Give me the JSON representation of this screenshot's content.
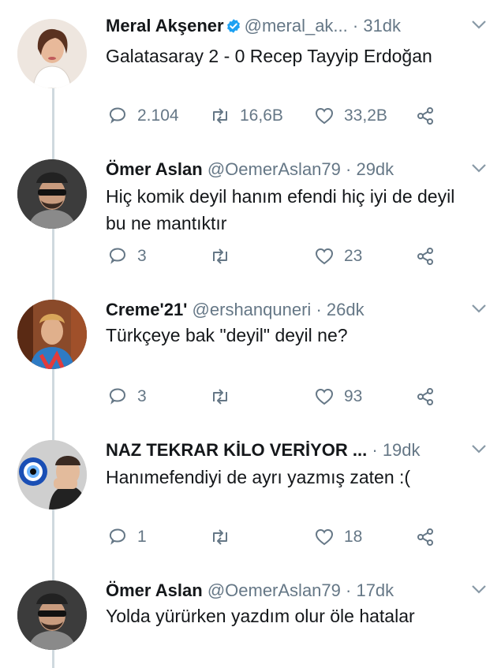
{
  "tweets": [
    {
      "name": "Meral Akşener",
      "verified": true,
      "handle": "@meral_ak...",
      "time": "· 31dk",
      "text": "Galatasaray 2 - 0 Recep Tayyip Erdoğan",
      "replies": "2.104",
      "retweets": "16,6B",
      "likes": "33,2B"
    },
    {
      "name": "Ömer Aslan",
      "verified": false,
      "handle": "@OemerAslan79",
      "time": "· 29dk",
      "text": "Hiç komik deyil hanım efendi hiç iyi de deyil bu ne mantıktır",
      "replies": "3",
      "retweets": "",
      "likes": "23"
    },
    {
      "name": "Creme'21'",
      "verified": false,
      "handle": "@ershanquneri",
      "time": "· 26dk",
      "text": "Türkçeye bak \"deyil\" deyil ne?",
      "replies": "3",
      "retweets": "",
      "likes": "93"
    },
    {
      "name": "NAZ TEKRAR KİLO VERİYOR ...",
      "verified": false,
      "handle": "",
      "time": "· 19dk",
      "text": "Hanımefendiyi de ayrı yazmış zaten :(",
      "replies": "1",
      "retweets": "",
      "likes": "18"
    },
    {
      "name": "Ömer Aslan",
      "verified": false,
      "handle": "@OemerAslan79",
      "time": "· 17dk",
      "text": "Yolda yürürken yazdım olur öle hatalar"
    }
  ],
  "colors": {
    "text": "#14171a",
    "secondary": "#657786",
    "verified": "#1da1f2",
    "thread_line": "#cfd9de"
  },
  "icons": [
    "reply-icon",
    "retweet-icon",
    "like-icon",
    "share-icon",
    "chevron-down-icon",
    "verified-badge-icon"
  ]
}
